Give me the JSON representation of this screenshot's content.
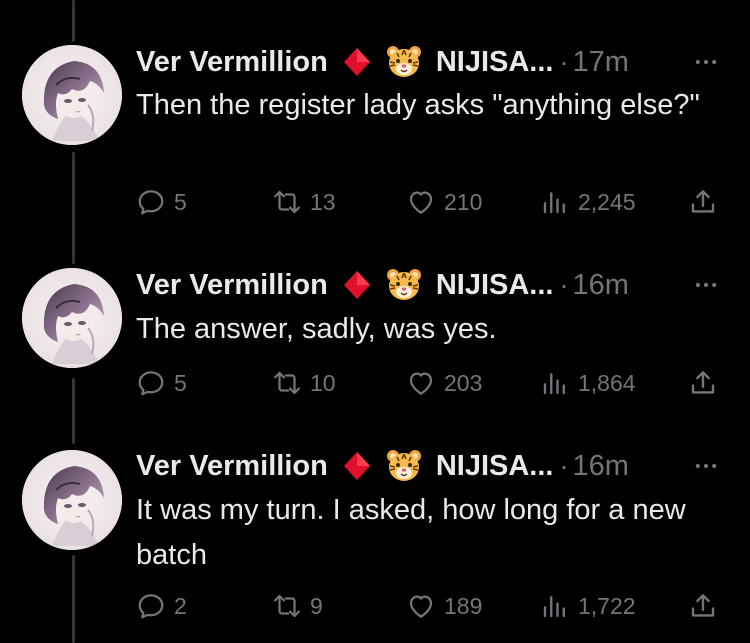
{
  "tweets": [
    {
      "author_name": "Ver Vermillion",
      "handle": "NIJISA...",
      "separator": "·",
      "time": "17m",
      "text": "Then the register lady asks \"anything else?\"",
      "replies": "5",
      "retweets": "13",
      "likes": "210",
      "views": "2,245"
    },
    {
      "author_name": "Ver Vermillion",
      "handle": "NIJISA...",
      "separator": "·",
      "time": "16m",
      "text": "The answer, sadly, was yes.",
      "replies": "5",
      "retweets": "10",
      "likes": "203",
      "views": "1,864"
    },
    {
      "author_name": "Ver Vermillion",
      "handle": "NIJISA...",
      "separator": "·",
      "time": "16m",
      "text": "It was my turn. I asked, how long for a new batch",
      "replies": "2",
      "retweets": "9",
      "likes": "189",
      "views": "1,722"
    }
  ],
  "icons": {
    "badge": "red-diamond-icon",
    "emoji": "tiger-face-icon",
    "reply": "reply-icon",
    "retweet": "retweet-icon",
    "like": "heart-icon",
    "views": "views-icon",
    "share": "share-icon",
    "more": "more-icon"
  },
  "colors": {
    "background": "#000000",
    "text": "#e7e9ea",
    "secondary": "#71767b",
    "thread_line": "#333639",
    "badge": "#e0102a"
  }
}
